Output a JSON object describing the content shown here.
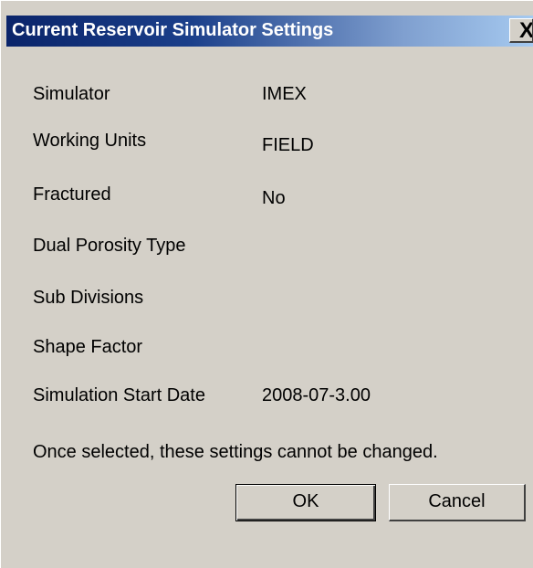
{
  "window": {
    "title": "Current Reservoir Simulator Settings",
    "close_glyph": "X"
  },
  "settings": [
    {
      "label": "Simulator",
      "value": "IMEX"
    },
    {
      "label": "Working Units",
      "value": "FIELD"
    },
    {
      "label": "Fractured",
      "value": "No"
    },
    {
      "label": "Dual Porosity Type",
      "value": ""
    },
    {
      "label": "Sub Divisions",
      "value": ""
    },
    {
      "label": "Shape Factor",
      "value": ""
    },
    {
      "label": "Simulation Start Date",
      "value": "2008-07-3.00"
    }
  ],
  "note": "Once selected, these settings cannot be changed.",
  "buttons": {
    "ok_label": "OK",
    "cancel_label": "Cancel"
  },
  "colors": {
    "titlebar_start": "#0a246a",
    "titlebar_end": "#a6caf0",
    "dialog_face": "#d4d0c8"
  }
}
